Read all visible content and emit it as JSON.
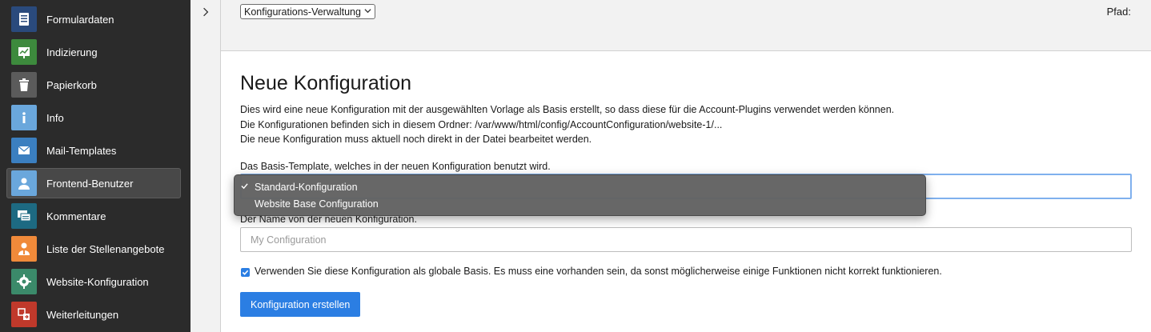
{
  "sidebar": {
    "items": [
      {
        "label": "Formulardaten",
        "icon": "form-icon",
        "color": "#2a4a7c"
      },
      {
        "label": "Indizierung",
        "icon": "chart-icon",
        "color": "#3d8a3d"
      },
      {
        "label": "Papierkorb",
        "icon": "trash-icon",
        "color": "#5b5b5b"
      },
      {
        "label": "Info",
        "icon": "info-icon",
        "color": "#6aa7dc"
      },
      {
        "label": "Mail-Templates",
        "icon": "mail-icon",
        "color": "#3b7fc0"
      },
      {
        "label": "Frontend-Benutzer",
        "icon": "user-icon",
        "color": "#6aa7dc"
      },
      {
        "label": "Kommentare",
        "icon": "comments-icon",
        "color": "#1d6a82"
      },
      {
        "label": "Liste der Stellenangebote",
        "icon": "job-icon",
        "color": "#f08a3a"
      },
      {
        "label": "Website-Konfiguration",
        "icon": "gear-icon",
        "color": "#3b8a6a"
      },
      {
        "label": "Weiterleitungen",
        "icon": "redirect-icon",
        "color": "#c0392b"
      }
    ],
    "active_index": 5
  },
  "topbar": {
    "module_select": "Konfigurations-Verwaltung",
    "path_label": "Pfad:"
  },
  "main": {
    "title": "Neue Konfiguration",
    "desc_1": "Dies wird eine neue Konfiguration mit der ausgewählten Vorlage als Basis erstellt, so dass diese für die Account-Plugins verwendet werden können.",
    "desc_2": "Die Konfigurationen befinden sich in diesem Ordner: /var/www/html/config/AccountConfiguration/website-1/...",
    "desc_3": "Die neue Konfiguration muss aktuell noch direkt in der Datei bearbeitet werden.",
    "template_label": "Das Basis-Template, welches in der neuen Konfiguration benutzt wird.",
    "name_label": "Der Name von der neuen Konfiguration.",
    "name_placeholder": "My Configuration",
    "global_checkbox_label": "Verwenden Sie diese Konfiguration als globale Basis. Es muss eine vorhanden sein, da sonst möglicherweise einige Funktionen nicht korrekt funktionieren.",
    "global_checked": true,
    "submit_label": "Konfiguration erstellen"
  },
  "dropdown": {
    "options": [
      "Standard-Konfiguration",
      "Website Base Configuration"
    ],
    "selected_index": 0
  },
  "colors": {
    "sidebar_bg": "#2b2b2b",
    "accent": "#2b7ee3",
    "focus_border": "#7fb0ee"
  }
}
